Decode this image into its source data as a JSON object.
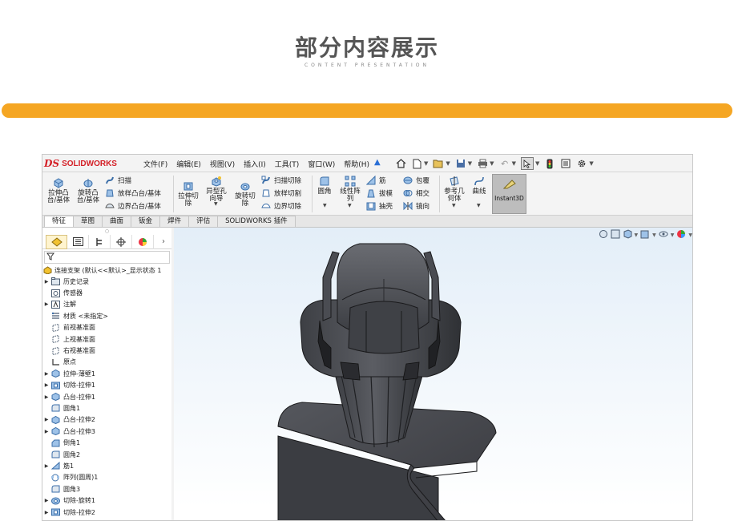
{
  "hero": {
    "title": "部分内容展示",
    "subtitle": "CONTENT PRESENTATION"
  },
  "colors": {
    "accent_bar": "#f5a623",
    "brand_red": "#d42027",
    "model_gray": "#4a4c52"
  },
  "app": {
    "logo": {
      "mark": "DS",
      "text": "SOLIDWORKS"
    },
    "menu": [
      "文件(F)",
      "编辑(E)",
      "视图(V)",
      "插入(I)",
      "工具(T)",
      "窗口(W)",
      "帮助(H)"
    ],
    "quick_access_icons": [
      "home-icon",
      "new-doc-icon",
      "open-icon",
      "save-icon",
      "print-icon",
      "undo-icon",
      "select-icon",
      "rebuild-icon",
      "file-properties-icon",
      "options-icon"
    ],
    "ribbon": {
      "extrude_boss": "拉伸凸\n台/基体",
      "revolve_boss": "旋转凸\n台/基体",
      "sweep": "扫描",
      "loft_boss": "放样凸台/基体",
      "boundary_boss": "边界凸台/基体",
      "extrude_cut": "拉伸切\n除",
      "hole_wizard": "异型孔\n向导",
      "revolve_cut": "旋转切\n除",
      "sweep_cut": "扫描切除",
      "loft_cut": "放样切割",
      "boundary_cut": "边界切除",
      "fillet": "圆角",
      "linear_pattern": "线性阵\n列",
      "rib": "筋",
      "draft": "拔模",
      "shell": "抽壳",
      "wrap": "包覆",
      "intersect": "相交",
      "mirror": "镜向",
      "reference_geometry": "参考几\n何体",
      "curves": "曲线",
      "instant3d": "Instant3D"
    },
    "tabs": [
      "特征",
      "草图",
      "曲面",
      "钣金",
      "焊件",
      "评估",
      "SOLIDWORKS 插件"
    ],
    "active_tab": "特征",
    "feature_tree": {
      "root": "连接支架 (默认<<默认>_显示状态 1",
      "items": [
        {
          "label": "历史记录",
          "icon": "history-folder-icon",
          "expandable": true
        },
        {
          "label": "传感器",
          "icon": "sensor-icon",
          "expandable": false
        },
        {
          "label": "注解",
          "icon": "annotation-icon",
          "expandable": true
        },
        {
          "label": "材质 <未指定>",
          "icon": "material-icon",
          "expandable": false
        },
        {
          "label": "前视基准面",
          "icon": "plane-icon",
          "expandable": false
        },
        {
          "label": "上视基准面",
          "icon": "plane-icon",
          "expandable": false
        },
        {
          "label": "右视基准面",
          "icon": "plane-icon",
          "expandable": false
        },
        {
          "label": "原点",
          "icon": "origin-icon",
          "expandable": false
        },
        {
          "label": "拉伸-薄壁1",
          "icon": "extrude-icon",
          "expandable": true
        },
        {
          "label": "切除-拉伸1",
          "icon": "cut-extrude-icon",
          "expandable": true
        },
        {
          "label": "凸台-拉伸1",
          "icon": "extrude-icon",
          "expandable": true
        },
        {
          "label": "圆角1",
          "icon": "fillet-icon",
          "expandable": false
        },
        {
          "label": "凸台-拉伸2",
          "icon": "extrude-icon",
          "expandable": true
        },
        {
          "label": "凸台-拉伸3",
          "icon": "extrude-icon",
          "expandable": true
        },
        {
          "label": "倒角1",
          "icon": "chamfer-icon",
          "expandable": false
        },
        {
          "label": "圆角2",
          "icon": "fillet-icon",
          "expandable": false
        },
        {
          "label": "筋1",
          "icon": "rib-icon",
          "expandable": true
        },
        {
          "label": "阵列(圆周)1",
          "icon": "circular-pattern-icon",
          "expandable": false
        },
        {
          "label": "圆角3",
          "icon": "fillet-icon",
          "expandable": false
        },
        {
          "label": "切除-旋转1",
          "icon": "cut-revolve-icon",
          "expandable": true
        },
        {
          "label": "切除-拉伸2",
          "icon": "cut-extrude-icon",
          "expandable": true
        }
      ]
    }
  }
}
